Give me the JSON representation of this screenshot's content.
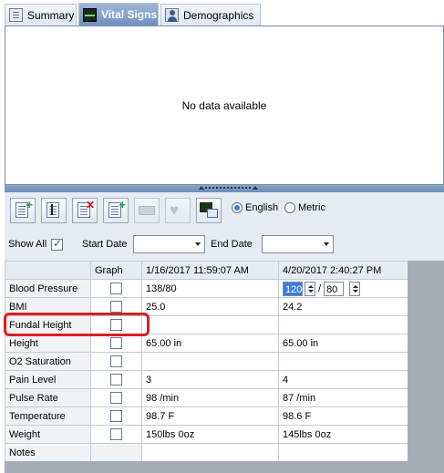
{
  "tabs": [
    {
      "label": "Summary",
      "icon": "summary-icon"
    },
    {
      "label": "Vital Signs",
      "icon": "vital-monitor-icon",
      "active": true
    },
    {
      "label": "Demographics",
      "icon": "person-icon"
    }
  ],
  "graph": {
    "empty_text": "No data available"
  },
  "toolbar": {
    "buttons": [
      "add-vital-icon",
      "edit-vital-icon",
      "delete-vital-icon",
      "add-multiple-icon",
      "print-icon",
      "heart-icon",
      "monitor-import-icon"
    ],
    "units": {
      "english": "English",
      "metric": "Metric",
      "selected": "English"
    }
  },
  "filter": {
    "show_all_label": "Show All",
    "show_all_checked": true,
    "start_date_label": "Start Date",
    "start_date_value": "",
    "end_date_label": "End Date",
    "end_date_value": ""
  },
  "grid": {
    "headers": [
      "",
      "Graph",
      "1/16/2017 11:59:07 AM",
      "4/20/2017 2:40:27 PM"
    ],
    "rows": [
      {
        "name": "Blood Pressure",
        "v1": "138/80",
        "v2": ""
      },
      {
        "name": "BMI",
        "v1": "25.0",
        "v2": "24.2"
      },
      {
        "name": "Fundal Height",
        "v1": "",
        "v2": ""
      },
      {
        "name": "Height",
        "v1": "65.00 in",
        "v2": "65.00 in"
      },
      {
        "name": "O2 Saturation",
        "v1": "",
        "v2": ""
      },
      {
        "name": "Pain Level",
        "v1": "3",
        "v2": "4"
      },
      {
        "name": "Pulse Rate",
        "v1": "98 /min",
        "v2": "87 /min"
      },
      {
        "name": "Temperature",
        "v1": "98.7 F",
        "v2": "98.6 F"
      },
      {
        "name": "Weight",
        "v1": "150lbs 0oz",
        "v2": "145lbs 0oz"
      },
      {
        "name": "Notes",
        "v1": "",
        "v2": ""
      }
    ],
    "bp_editor": {
      "systolic": "120",
      "separator": "/",
      "diastolic": "80"
    }
  },
  "colors": {
    "highlight": "#dc1f1f",
    "accent": "#2f7de0"
  }
}
